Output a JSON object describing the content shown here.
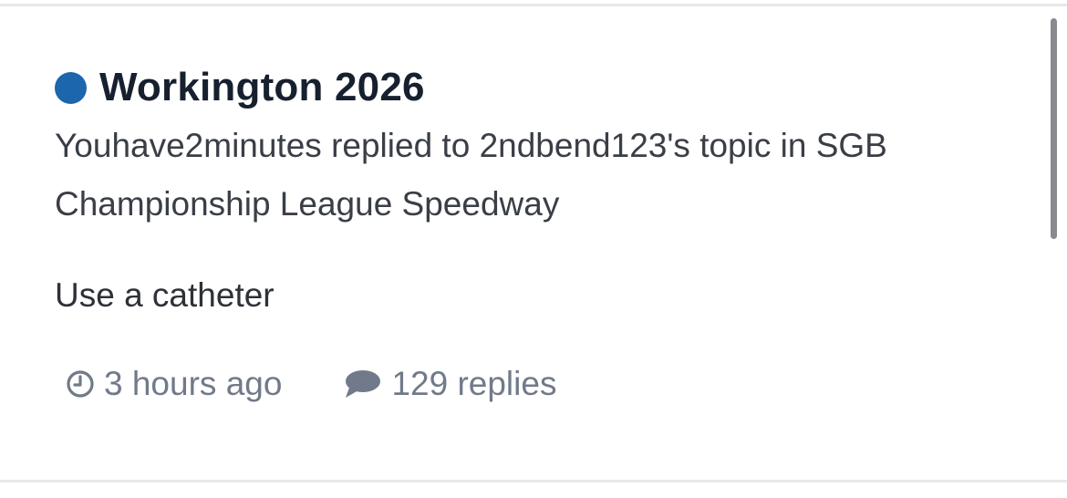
{
  "topic": {
    "title": "Workington 2026",
    "unread_indicator_color": "#1c66ad",
    "subtitle": "Youhave2minutes replied to 2ndbend123's topic in SGB Championship League Speedway",
    "snippet": "Use a catheter"
  },
  "meta": {
    "time": "3 hours ago",
    "time_icon": "clock-icon",
    "replies": "129 replies",
    "replies_icon": "comment-icon"
  },
  "colors": {
    "accent": "#1c66ad",
    "title": "#17202e",
    "body_text": "#3a3e46",
    "meta_text": "#717a8a",
    "divider": "#e8e8ea"
  }
}
